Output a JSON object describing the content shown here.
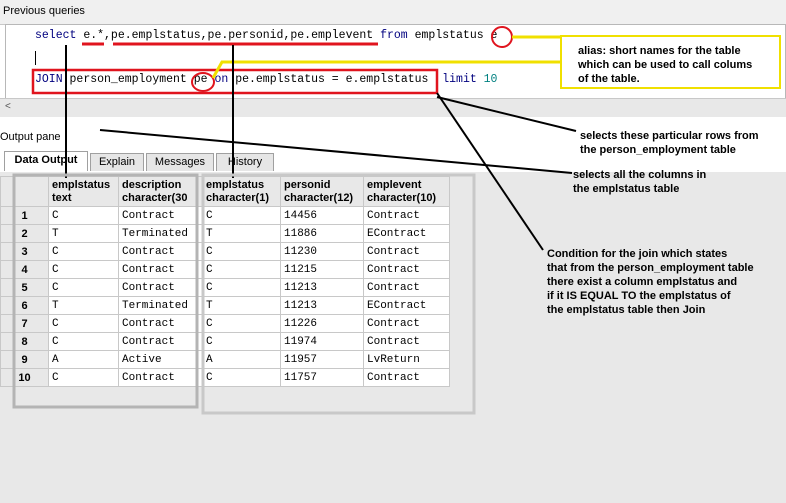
{
  "window": {
    "previous_queries_label": "Previous queries"
  },
  "editor": {
    "line1": {
      "kw_select": "select",
      "cols": "e.*,pe.emplstatus,pe.personid,pe.emplevent",
      "kw_from": "from",
      "table": "emplstatus",
      "alias": "e"
    },
    "line2": {
      "kw_join": "JOIN",
      "table": "person_employment",
      "alias": "pe",
      "kw_on": "on",
      "condition": "pe.emplstatus = e.emplstatus",
      "kw_limit": "limit",
      "limit_value": "10"
    },
    "scroll_left_glyph": "<"
  },
  "output_pane_label": "Output pane",
  "tabs": [
    {
      "label": "Data Output"
    },
    {
      "label": "Explain"
    },
    {
      "label": "Messages"
    },
    {
      "label": "History"
    }
  ],
  "grid": {
    "columns": [
      {
        "name": "emplstatus",
        "type": "text"
      },
      {
        "name": "description",
        "type": "character(30"
      },
      {
        "name": "emplstatus",
        "type": "character(1)"
      },
      {
        "name": "personid",
        "type": "character(12)"
      },
      {
        "name": "emplevent",
        "type": "character(10)"
      }
    ],
    "rows": [
      {
        "n": "1",
        "cells": [
          "C",
          "Contract",
          "C",
          "14456",
          "Contract"
        ]
      },
      {
        "n": "2",
        "cells": [
          "T",
          "Terminated",
          "T",
          "11886",
          "EContract"
        ]
      },
      {
        "n": "3",
        "cells": [
          "C",
          "Contract",
          "C",
          "11230",
          "Contract"
        ]
      },
      {
        "n": "4",
        "cells": [
          "C",
          "Contract",
          "C",
          "11215",
          "Contract"
        ]
      },
      {
        "n": "5",
        "cells": [
          "C",
          "Contract",
          "C",
          "11213",
          "Contract"
        ]
      },
      {
        "n": "6",
        "cells": [
          "T",
          "Terminated",
          "T",
          "11213",
          "EContract"
        ]
      },
      {
        "n": "7",
        "cells": [
          "C",
          "Contract",
          "C",
          "11226",
          "Contract"
        ]
      },
      {
        "n": "8",
        "cells": [
          "C",
          "Contract",
          "C",
          "11974",
          "Contract"
        ]
      },
      {
        "n": "9",
        "cells": [
          "A",
          "Active",
          "A",
          "11957",
          "LvReturn"
        ]
      },
      {
        "n": "10",
        "cells": [
          "C",
          "Contract",
          "C",
          "11757",
          "Contract"
        ]
      }
    ]
  },
  "annotations": {
    "alias_note": [
      "alias:  short names for the table",
      "which can be used to call colums",
      "of the table."
    ],
    "rows_note": [
      "selects these particular rows from",
      "the person_employment table"
    ],
    "columns_note": [
      "selects all the columns in",
      "the emplstatus table"
    ],
    "join_note": [
      "Condition for the join which states",
      "that from the person_employment table",
      "there exist a column emplstatus and",
      "if it IS EQUAL TO the emplstatus of",
      "the emplstatus table then Join"
    ]
  },
  "colors": {
    "annotation_red": "#e0141e",
    "annotation_yellow": "#f0e000",
    "keyword_blue": "#00007f",
    "number_teal": "#008080"
  }
}
